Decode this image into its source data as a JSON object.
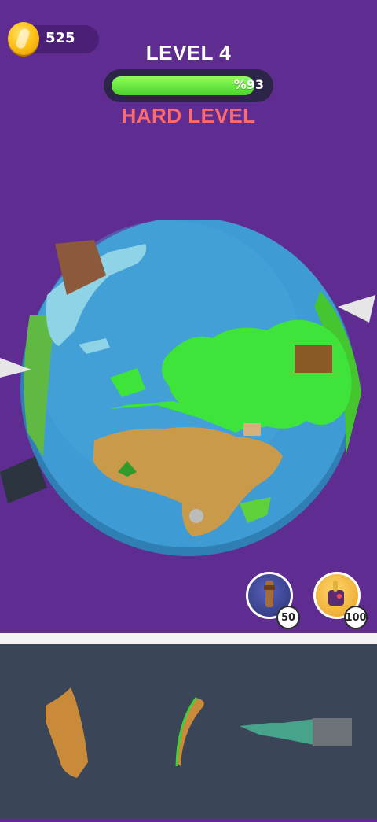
{
  "hud": {
    "coins": "525",
    "level_title": "LEVEL 4",
    "progress_text": "%93",
    "progress_fraction": 0.93,
    "difficulty": "HARD LEVEL"
  },
  "powerups": [
    {
      "icon": "telescope-icon",
      "cost": "50"
    },
    {
      "icon": "gauntlet-icon",
      "cost": "100"
    }
  ],
  "tray": {
    "pieces": [
      "brown-land-piece",
      "green-brown-sliver-piece",
      "statue-of-liberty-piece"
    ]
  },
  "colors": {
    "background": "#5f2c92",
    "ocean": "#3f9ad1",
    "land_green": "#3ee43a",
    "land_brown": "#c99a4a",
    "progress": "#5fe23a",
    "difficulty": "#ff6b6b",
    "tray": "#3a4658"
  }
}
